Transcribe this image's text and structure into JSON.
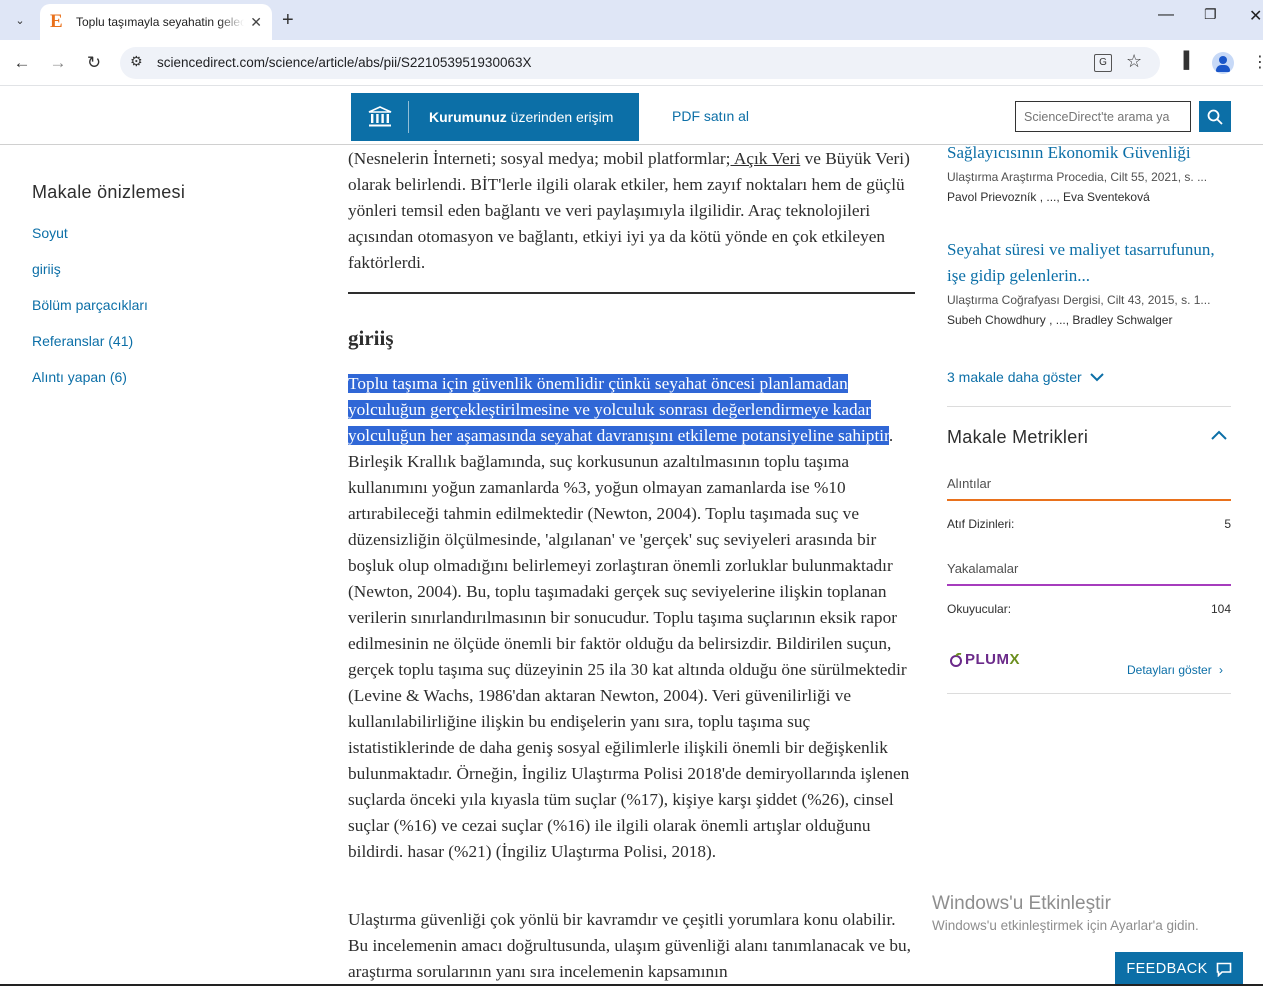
{
  "browser": {
    "tab_title": "Toplu taşımayla seyahatin geleceği",
    "url": "sciencedirect.com/science/article/abs/pii/S221053951930063X"
  },
  "header": {
    "access_bold": "Kurumunuz",
    "access_rest": " üzerinden erişim",
    "pdf_label": "PDF satın al",
    "search_placeholder": "ScienceDirect'te arama ya"
  },
  "leftnav": {
    "title": "Makale önizlemesi",
    "items": [
      {
        "label": "Soyut"
      },
      {
        "label": "giriiş"
      },
      {
        "label": "Bölüm parçacıkları"
      },
      {
        "label": "Referanslar (41)"
      },
      {
        "label": "Alıntı yapan (6)"
      }
    ]
  },
  "article": {
    "prev_p_before_link": "(Nesnelerin İnterneti; sosyal medya; mobil platformlar;",
    "prev_p_link": " Açık Veri",
    "prev_p_after_link": " ve Büyük Veri) olarak belirlendi. BİT'lerle ilgili olarak etkiler, hem zayıf noktaları hem de güçlü yönleri temsil eden bağlantı ve veri paylaşımıyla ilgilidir. Araç teknolojileri açısından otomasyon ve bağlantı, etkiyi iyi ya da kötü yönde en çok etkileyen faktörlerdi.",
    "section_title": "giriiş",
    "p1_highlighted": "Toplu taşıma için güvenlik önemlidir çünkü seyahat öncesi planlamadan yolculuğun gerçekleştirilmesine ve yolculuk sonrası değerlendirmeye kadar yolculuğun her aşamasında seyahat davranışını etkileme potansiyeline sahiptir",
    "p1_rest": ". Birleşik Krallık bağlamında, suç korkusunun azaltılmasının toplu taşıma kullanımını yoğun zamanlarda %3, yoğun olmayan zamanlarda ise %10 artırabileceği tahmin edilmektedir (Newton, 2004). Toplu taşımada suç ve düzensizliğin ölçülmesinde, 'algılanan' ve 'gerçek' suç seviyeleri arasında bir boşluk olup olmadığını belirlemeyi zorlaştıran önemli zorluklar bulunmaktadır (Newton, 2004). Bu, toplu taşımadaki gerçek suç seviyelerine ilişkin toplanan verilerin sınırlandırılmasının bir sonucudur. Toplu taşıma suçlarının eksik rapor edilmesinin ne ölçüde önemli bir faktör olduğu da belirsizdir. Bildirilen suçun, gerçek toplu taşıma suç düzeyinin 25 ila 30 kat altında olduğu öne sürülmektedir (Levine & Wachs, 1986'dan aktaran Newton, 2004). Veri güvenilirliği ve kullanılabilirliğine ilişkin bu endişelerin yanı sıra, toplu taşıma suç istatistiklerinde de daha geniş sosyal eğilimlerle ilişkili önemli bir değişkenlik bulunmaktadır. Örneğin, İngiliz Ulaştırma Polisi 2018'de demiryollarında işlenen suçlarda önceki yıla kıyasla tüm suçlar (%17), kişiye karşı şiddet (%26), cinsel suçlar (%16) ve cezai suçlar (%16) ile ilgili olarak önemli artışlar olduğunu bildirdi. hasar (%21) (İngiliz Ulaştırma Polisi, 2018).",
    "p2": "Ulaştırma güvenliği çok yönlü bir kavramdır ve çeşitli yorumlara konu olabilir. Bu incelemenin amacı doğrultusunda, ulaşım güvenliği alanı tanımlanacak ve bu, araştırma sorularının yanı sıra incelemenin kapsamının"
  },
  "related": [
    {
      "title": "Sağlayıcısının Ekonomik Güvenliği",
      "meta": "Ulaştırma Araştırma Procedia, Cilt 55, 2021, s. ...",
      "authors": "Pavol Prievozník , ..., Eva Sventeková"
    },
    {
      "title": "Seyahat süresi ve maliyet tasarrufunun, işe gidip gelenlerin...",
      "meta": "Ulaştırma Coğrafyası Dergisi, Cilt 43, 2015, s. 1...",
      "authors": "Subeh Chowdhury , ..., Bradley Schwalger"
    }
  ],
  "more_articles": "3 makale daha göster",
  "metrics": {
    "title": "Makale Metrikleri",
    "citations_label": "Alıntılar",
    "citation_index_label": "Atıf Dizinleri:",
    "citation_index_value": "5",
    "captures_label": "Yakalamalar",
    "readers_label": "Okuyucular:",
    "readers_value": "104",
    "plumx_a": "PLUM",
    "plumx_b": "X",
    "details": "Detayları göster",
    "colors": {
      "citations": "#e9711c",
      "captures": "#a63cbd"
    }
  },
  "watermark": {
    "line1": "Windows'u Etkinleştir",
    "line2": "Windows'u etkinleştirmek için Ayarlar'a gidin."
  },
  "feedback": "FEEDBACK"
}
